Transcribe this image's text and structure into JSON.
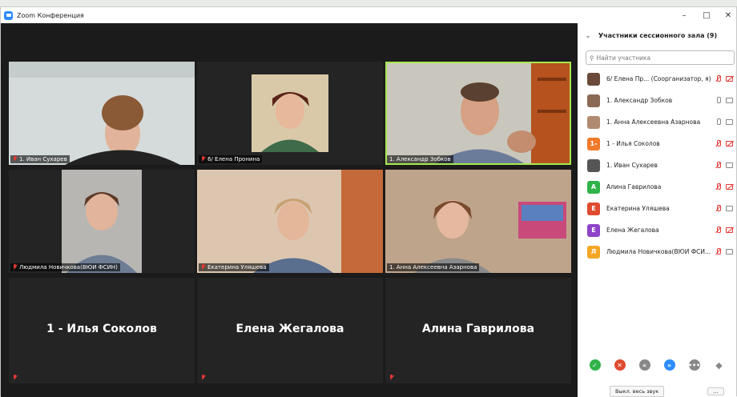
{
  "window": {
    "title": "Zoom Конференция",
    "minimize": "–",
    "maximize": "□",
    "close": "✕"
  },
  "video_tiles": [
    {
      "name": "1. Иван Сухарев",
      "muted": true
    },
    {
      "name": "6/ Елена Пронина",
      "muted": true
    },
    {
      "name": "1. Александр Зобков",
      "muted": false,
      "active": true
    },
    {
      "name": "Людмила Новичкова(ВЮИ ФСИН)",
      "muted": true
    },
    {
      "name": "Екатерина Уляшева",
      "muted": true
    },
    {
      "name": "1. Анна Алексеевна Азарнова",
      "muted": false
    },
    {
      "name": "1 - Илья Соколов",
      "muted": true
    },
    {
      "name": "Елена Жегалова",
      "muted": true
    },
    {
      "name": "Алина Гаврилова",
      "muted": true
    }
  ],
  "panel": {
    "title": "Участники сессионного зала (9)",
    "search_placeholder": "Найти участника",
    "participants": [
      {
        "name": "6/ Елена Пр...  (Соорганизатор, я)",
        "avatar": "photo",
        "color": "#6b4a3a",
        "mic": "red",
        "cam": "red"
      },
      {
        "name": "1. Александр Зобков",
        "avatar": "photo",
        "color": "#8a6a55",
        "mic": "gray",
        "cam": "gray"
      },
      {
        "name": "1. Анна Алексеевна Азарнова",
        "avatar": "photo",
        "color": "#b08a70",
        "mic": "gray",
        "cam": "gray"
      },
      {
        "name": "1 - Илья Соколов",
        "avatar": "1-",
        "color": "#f07a2a",
        "mic": "red",
        "cam": "red"
      },
      {
        "name": "1. Иван Сухарев",
        "avatar": "photo",
        "color": "#555555",
        "mic": "red",
        "cam": "gray"
      },
      {
        "name": "Алина Гаврилова",
        "avatar": "А",
        "color": "#2fb34a",
        "mic": "red",
        "cam": "red"
      },
      {
        "name": "Екатерина Уляшева",
        "avatar": "Е",
        "color": "#e04a2f",
        "mic": "red",
        "cam": "gray"
      },
      {
        "name": "Елена Жегалова",
        "avatar": "Е",
        "color": "#8e44c9",
        "mic": "red",
        "cam": "red"
      },
      {
        "name": "Людмила Новичкова(ВЮИ ФСИ...",
        "avatar": "Л",
        "color": "#f5a623",
        "mic": "red",
        "cam": "gray"
      }
    ],
    "mute_all": "Выкл. весь звук",
    "more": "..."
  }
}
